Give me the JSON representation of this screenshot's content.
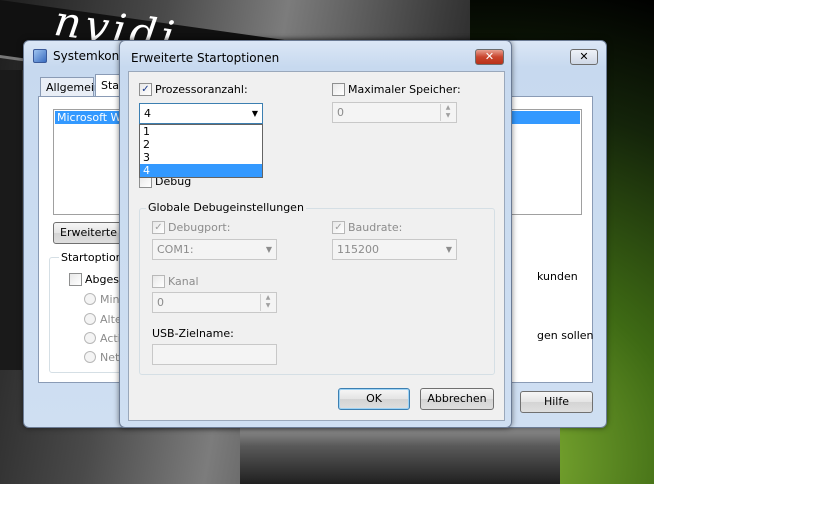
{
  "desktop": {
    "logo_text": "nvidi"
  },
  "back_window": {
    "title": "Systemkonfi",
    "close_glyph": "✕",
    "tabs": [
      "Allgemein",
      "Star"
    ],
    "boot_list_item": "Microsoft Win",
    "advanced_button": "Erweiterte O",
    "startoptions_label": "Startoptione",
    "safe_boot_label": "Abgesic",
    "radio_labels": [
      "Minin",
      "Alter",
      "Activ",
      "Netz"
    ],
    "timeout_unit": "kunden",
    "permanent_text": "gen sollen",
    "help_button": "Hilfe"
  },
  "dialog": {
    "title": "Erweiterte Startoptionen",
    "close_glyph": "✕",
    "processor_count_label": "Prozessoranzahl:",
    "processor_count_checked": true,
    "processor_count_value": "4",
    "processor_dropdown_options": [
      "1",
      "2",
      "3",
      "4"
    ],
    "processor_dropdown_selected": "4",
    "max_memory_label": "Maximaler Speicher:",
    "max_memory_checked": false,
    "max_memory_value": "0",
    "debug_label": "Debug",
    "global_debug_group": "Globale Debugeinstellungen",
    "debugport_label": "Debugport:",
    "debugport_value": "COM1:",
    "baudrate_label": "Baudrate:",
    "baudrate_value": "115200",
    "kanal_label": "Kanal",
    "kanal_value": "0",
    "usb_label": "USB-Zielname:",
    "usb_value": "",
    "ok_button": "OK",
    "cancel_button": "Abbrechen"
  },
  "icons": {
    "checkmark": "✓",
    "dropdown_arrow": "▼",
    "spin_up": "▲",
    "spin_down": "▼"
  },
  "colors": {
    "selection": "#3399ff",
    "close_red": "#c9452e",
    "ok_focus": "#3c7fb1"
  }
}
